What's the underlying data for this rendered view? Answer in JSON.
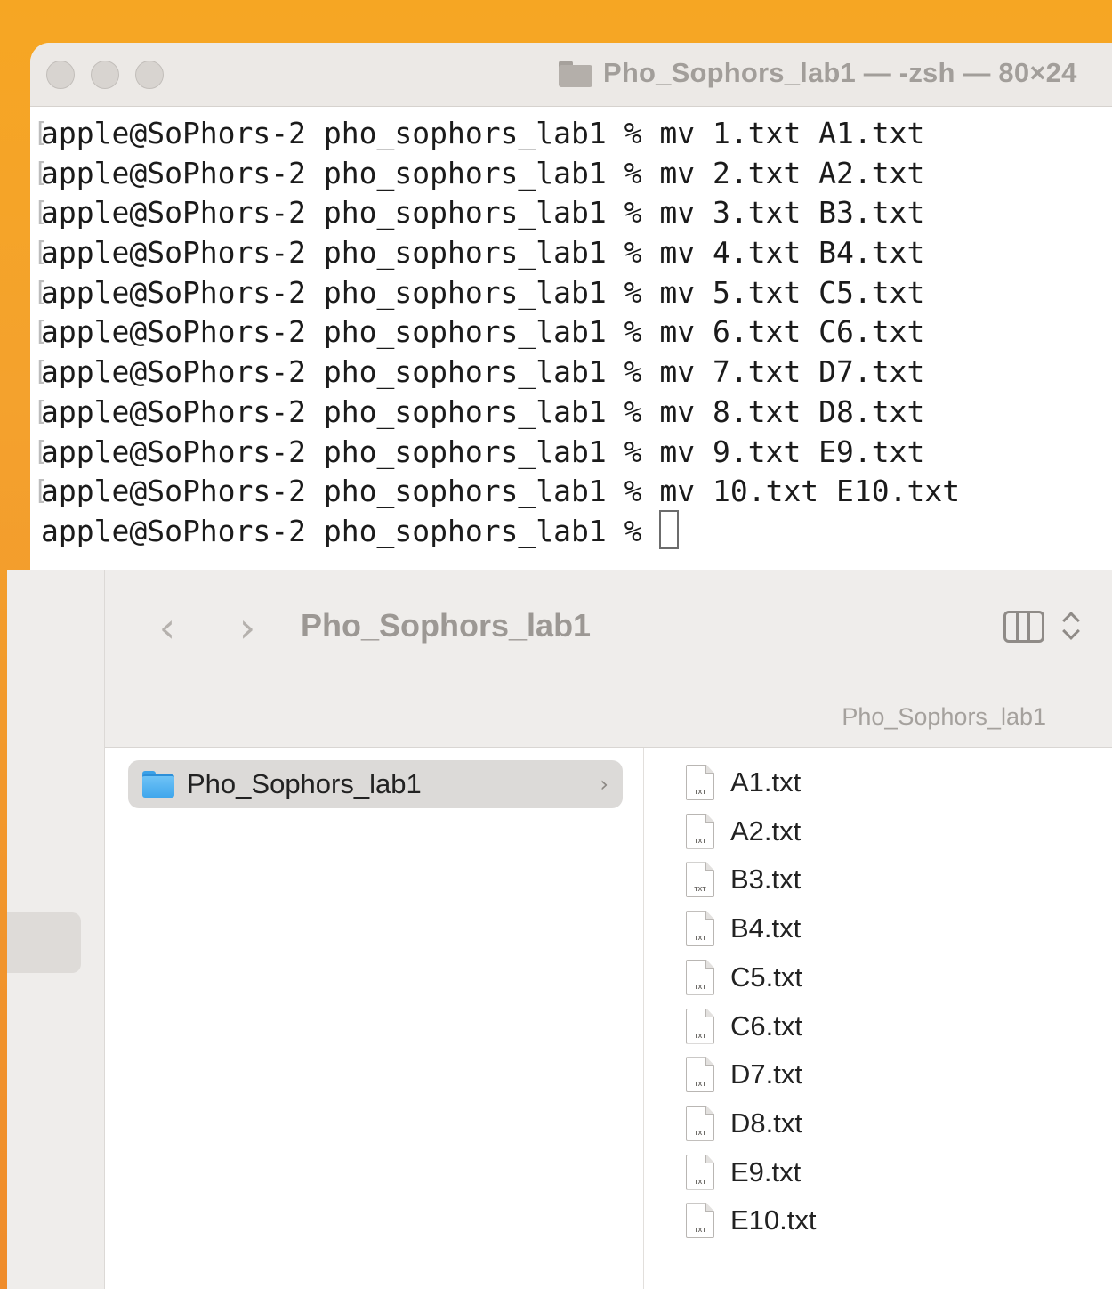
{
  "terminal": {
    "title": "Pho_Sophors_lab1 — -zsh — 80×24",
    "lines": [
      "apple@SoPhors-2 pho_sophors_lab1 % mv 1.txt A1.txt",
      "apple@SoPhors-2 pho_sophors_lab1 % mv 2.txt A2.txt",
      "apple@SoPhors-2 pho_sophors_lab1 % mv 3.txt B3.txt",
      "apple@SoPhors-2 pho_sophors_lab1 % mv 4.txt B4.txt",
      "apple@SoPhors-2 pho_sophors_lab1 % mv 5.txt C5.txt",
      "apple@SoPhors-2 pho_sophors_lab1 % mv 6.txt C6.txt",
      "apple@SoPhors-2 pho_sophors_lab1 % mv 7.txt D7.txt",
      "apple@SoPhors-2 pho_sophors_lab1 % mv 8.txt D8.txt",
      "apple@SoPhors-2 pho_sophors_lab1 % mv 9.txt E9.txt",
      "apple@SoPhors-2 pho_sophors_lab1 % mv 10.txt E10.txt"
    ],
    "prompt": "apple@SoPhors-2 pho_sophors_lab1 % "
  },
  "finder": {
    "title": "Pho_Sophors_lab1",
    "back_glyph": "‹",
    "forward_glyph": "›",
    "path_label": "Pho_Sophors_lab1",
    "column1": {
      "folder_label": "Pho_Sophors_lab1",
      "chevron": "›"
    },
    "file_badge": "TXT",
    "files": [
      "A1.txt",
      "A2.txt",
      "B3.txt",
      "B4.txt",
      "C5.txt",
      "C6.txt",
      "D7.txt",
      "D8.txt",
      "E9.txt",
      "E10.txt"
    ]
  },
  "icons": {
    "terminal_folder": "folder-icon",
    "view_toggle": "column-view-icon",
    "sort": "chevron-updown-icon",
    "folder": "blue-folder-icon",
    "file": "txt-file-icon"
  },
  "colors": {
    "desktop": "#f6a623",
    "folder_blue": "#3fa6ec",
    "window_chrome": "#ece9e6"
  }
}
